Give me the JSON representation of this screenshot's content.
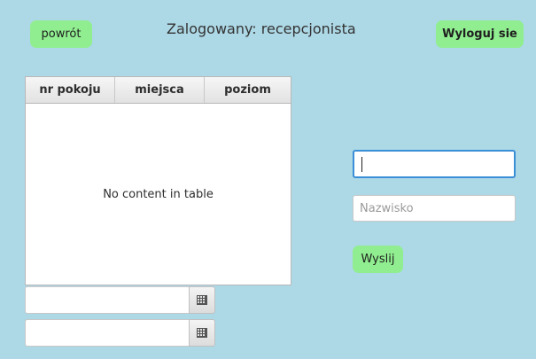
{
  "header": {
    "back_label": "powrót",
    "login_status": "Zalogowany: recepcjonista",
    "logout_label": "Wyloguj sie"
  },
  "rooms_table": {
    "columns": [
      "nr pokoju",
      "miejsca",
      "poziom"
    ],
    "empty_text": "No content in table"
  },
  "date_pickers": {
    "from_value": "",
    "to_value": "",
    "calendar_icon": "calendar-icon"
  },
  "form": {
    "first_name_value": "",
    "surname_placeholder": "Nazwisko",
    "submit_label": "Wyslij"
  },
  "colors": {
    "background": "#add8e6",
    "button": "#90ee90",
    "focus_border": "#3a8fd6"
  }
}
